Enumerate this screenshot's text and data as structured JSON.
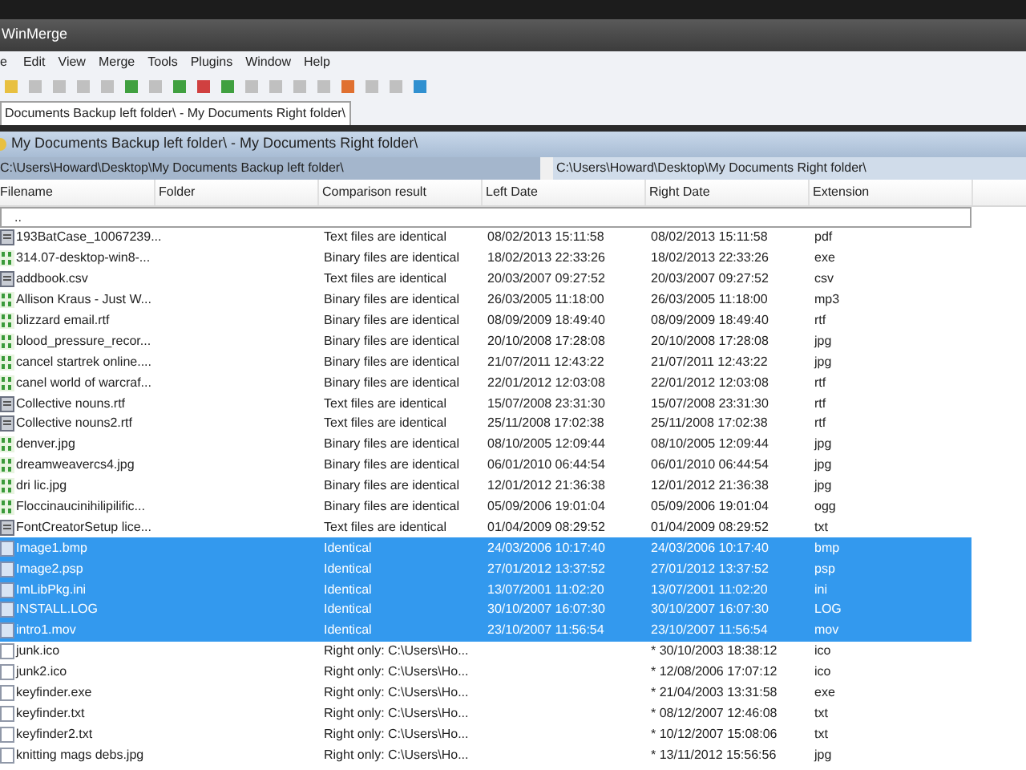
{
  "window": {
    "title": "WinMerge"
  },
  "menu": [
    "e",
    "Edit",
    "View",
    "Merge",
    "Tools",
    "Plugins",
    "Window",
    "Help"
  ],
  "tab": {
    "label": "Documents Backup left folder\\ - My Documents Right folder\\",
    "selected": true
  },
  "compare_title": "My Documents Backup left folder\\ - My Documents Right folder\\",
  "paths": {
    "left": "C:\\Users\\Howard\\Desktop\\My Documents Backup left folder\\",
    "right": "C:\\Users\\Howard\\Desktop\\My Documents Right folder\\"
  },
  "table": {
    "columns": [
      "Filename",
      "Folder",
      "Comparison result",
      "Left Date",
      "Right Date",
      "Extension"
    ],
    "parent_row": "..",
    "rows": [
      {
        "kind": "text",
        "name": "193BatCase_10067239...",
        "result": "Text files are identical",
        "left": "08/02/2013 15:11:58",
        "right": "08/02/2013 15:11:58",
        "ext": "pdf",
        "selected": false
      },
      {
        "kind": "binary",
        "name": "314.07-desktop-win8-...",
        "result": "Binary files are identical",
        "left": "18/02/2013 22:33:26",
        "right": "18/02/2013 22:33:26",
        "ext": "exe",
        "selected": false
      },
      {
        "kind": "text",
        "name": "addbook.csv",
        "result": "Text files are identical",
        "left": "20/03/2007 09:27:52",
        "right": "20/03/2007 09:27:52",
        "ext": "csv",
        "selected": false
      },
      {
        "kind": "binary",
        "name": "Allison Kraus  - Just W...",
        "result": "Binary files are identical",
        "left": "26/03/2005 11:18:00",
        "right": "26/03/2005 11:18:00",
        "ext": "mp3",
        "selected": false
      },
      {
        "kind": "binary",
        "name": "blizzard email.rtf",
        "result": "Binary files are identical",
        "left": "08/09/2009 18:49:40",
        "right": "08/09/2009 18:49:40",
        "ext": "rtf",
        "selected": false
      },
      {
        "kind": "binary",
        "name": "blood_pressure_recor...",
        "result": "Binary files are identical",
        "left": "20/10/2008 17:28:08",
        "right": "20/10/2008 17:28:08",
        "ext": "jpg",
        "selected": false
      },
      {
        "kind": "binary",
        "name": "cancel startrek online....",
        "result": "Binary files are identical",
        "left": "21/07/2011 12:43:22",
        "right": "21/07/2011 12:43:22",
        "ext": "jpg",
        "selected": false
      },
      {
        "kind": "binary",
        "name": "canel world of warcraf...",
        "result": "Binary files are identical",
        "left": "22/01/2012 12:03:08",
        "right": "22/01/2012 12:03:08",
        "ext": "rtf",
        "selected": false
      },
      {
        "kind": "text",
        "name": "Collective nouns.rtf",
        "result": "Text files are identical",
        "left": "15/07/2008 23:31:30",
        "right": "15/07/2008 23:31:30",
        "ext": "rtf",
        "selected": false
      },
      {
        "kind": "text",
        "name": "Collective nouns2.rtf",
        "result": "Text files are identical",
        "left": "25/11/2008 17:02:38",
        "right": "25/11/2008 17:02:38",
        "ext": "rtf",
        "selected": false
      },
      {
        "kind": "binary",
        "name": "denver.jpg",
        "result": "Binary files are identical",
        "left": "08/10/2005 12:09:44",
        "right": "08/10/2005 12:09:44",
        "ext": "jpg",
        "selected": false
      },
      {
        "kind": "binary",
        "name": "dreamweavercs4.jpg",
        "result": "Binary files are identical",
        "left": "06/01/2010 06:44:54",
        "right": "06/01/2010 06:44:54",
        "ext": "jpg",
        "selected": false
      },
      {
        "kind": "binary",
        "name": "dri lic.jpg",
        "result": "Binary files are identical",
        "left": "12/01/2012 21:36:38",
        "right": "12/01/2012 21:36:38",
        "ext": "jpg",
        "selected": false
      },
      {
        "kind": "binary",
        "name": "Floccinaucinihilipilific...",
        "result": "Binary files are identical",
        "left": "05/09/2006 19:01:04",
        "right": "05/09/2006 19:01:04",
        "ext": "ogg",
        "selected": false
      },
      {
        "kind": "text",
        "name": "FontCreatorSetup lice...",
        "result": "Text files are identical",
        "left": "01/04/2009 08:29:52",
        "right": "01/04/2009 08:29:52",
        "ext": "txt",
        "selected": false
      },
      {
        "kind": "identical",
        "name": "Image1.bmp",
        "result": "Identical",
        "left": "24/03/2006 10:17:40",
        "right": "24/03/2006 10:17:40",
        "ext": "bmp",
        "selected": true
      },
      {
        "kind": "identical",
        "name": "Image2.psp",
        "result": "Identical",
        "left": "27/01/2012 13:37:52",
        "right": "27/01/2012 13:37:52",
        "ext": "psp",
        "selected": true
      },
      {
        "kind": "identical",
        "name": "ImLibPkg.ini",
        "result": "Identical",
        "left": "13/07/2001 11:02:20",
        "right": "13/07/2001 11:02:20",
        "ext": "ini",
        "selected": true
      },
      {
        "kind": "identical",
        "name": "INSTALL.LOG",
        "result": "Identical",
        "left": "30/10/2007 16:07:30",
        "right": "30/10/2007 16:07:30",
        "ext": "LOG",
        "selected": true
      },
      {
        "kind": "identical",
        "name": "intro1.mov",
        "result": "Identical",
        "left": "23/10/2007 11:56:54",
        "right": "23/10/2007 11:56:54",
        "ext": "mov",
        "selected": true
      },
      {
        "kind": "right-only",
        "name": "junk.ico",
        "result": "Right only: C:\\Users\\Ho...",
        "right": "* 30/10/2003 18:38:12",
        "ext": "ico",
        "selected": false
      },
      {
        "kind": "right-only",
        "name": "junk2.ico",
        "result": "Right only: C:\\Users\\Ho...",
        "right": "* 12/08/2006 17:07:12",
        "ext": "ico",
        "selected": false
      },
      {
        "kind": "right-only",
        "name": "keyfinder.exe",
        "result": "Right only: C:\\Users\\Ho...",
        "right": "* 21/04/2003 13:31:58",
        "ext": "exe",
        "selected": false
      },
      {
        "kind": "right-only",
        "name": "keyfinder.txt",
        "result": "Right only: C:\\Users\\Ho...",
        "right": "* 08/12/2007 12:46:08",
        "ext": "txt",
        "selected": false
      },
      {
        "kind": "right-only",
        "name": "keyfinder2.txt",
        "result": "Right only: C:\\Users\\Ho...",
        "right": "* 10/12/2007 15:08:06",
        "ext": "txt",
        "selected": false
      },
      {
        "kind": "right-only",
        "name": "knitting mags debs.jpg",
        "result": "Right only: C:\\Users\\Ho...",
        "right": "* 13/11/2012 15:56:56",
        "ext": "jpg",
        "selected": false
      }
    ]
  }
}
